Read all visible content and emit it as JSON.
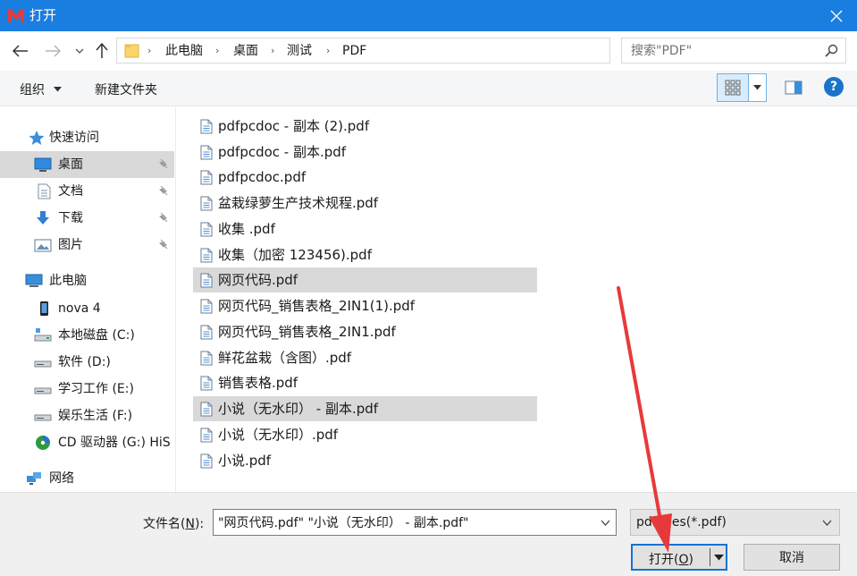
{
  "window": {
    "title": "打开",
    "logo_letter": "M",
    "accent_color": "#1a7ee0"
  },
  "address": {
    "crumbs": [
      "此电脑",
      "桌面",
      "测试",
      "PDF"
    ],
    "search_placeholder": "搜索\"PDF\""
  },
  "toolbar": {
    "organize_label": "组织",
    "new_folder_label": "新建文件夹",
    "help_label": "?"
  },
  "nav": {
    "items": [
      {
        "label": "快速访问",
        "icon": "star-icon"
      },
      {
        "label": "桌面",
        "icon": "desktop-icon"
      },
      {
        "label": "文档",
        "icon": "document-icon"
      },
      {
        "label": "下载",
        "icon": "download-icon"
      },
      {
        "label": "图片",
        "icon": "picture-icon"
      },
      {
        "label": "此电脑",
        "icon": "computer-icon"
      },
      {
        "label": "nova 4",
        "icon": "phone-icon"
      },
      {
        "label": "本地磁盘 (C:)",
        "icon": "drive-icon"
      },
      {
        "label": "软件 (D:)",
        "icon": "drive-icon"
      },
      {
        "label": "学习工作 (E:)",
        "icon": "drive-icon"
      },
      {
        "label": "娱乐生活 (F:)",
        "icon": "drive-icon"
      },
      {
        "label": "CD 驱动器 (G:) HiS",
        "icon": "cd-drive-icon"
      },
      {
        "label": "网络",
        "icon": "network-icon"
      }
    ]
  },
  "files": [
    {
      "name": "pdfpcdoc - 副本 (2).pdf"
    },
    {
      "name": "pdfpcdoc - 副本.pdf"
    },
    {
      "name": "pdfpcdoc.pdf"
    },
    {
      "name": "盆栽绿萝生产技术规程.pdf"
    },
    {
      "name": "收集 .pdf"
    },
    {
      "name": "收集（加密 123456).pdf"
    },
    {
      "name": "网页代码.pdf"
    },
    {
      "name": "网页代码_销售表格_2IN1(1).pdf"
    },
    {
      "name": "网页代码_销售表格_2IN1.pdf"
    },
    {
      "name": "鲜花盆栽（含图）.pdf"
    },
    {
      "name": "销售表格.pdf"
    },
    {
      "name": "小说（无水印） - 副本.pdf"
    },
    {
      "name": "小说（无水印）.pdf"
    },
    {
      "name": "小说.pdf"
    }
  ],
  "bottom": {
    "filename_label_prefix": "文件名(",
    "filename_label_key": "N",
    "filename_label_suffix": "):",
    "filename_value": "\"网页代码.pdf\" \"小说（无水印） - 副本.pdf\"",
    "filter_value": "pdf files(*.pdf)",
    "open_label_prefix": "打开(",
    "open_label_key": "O",
    "open_label_suffix": ")",
    "cancel_label": "取消"
  },
  "annotation": {
    "arrow_color": "#e8393a"
  }
}
